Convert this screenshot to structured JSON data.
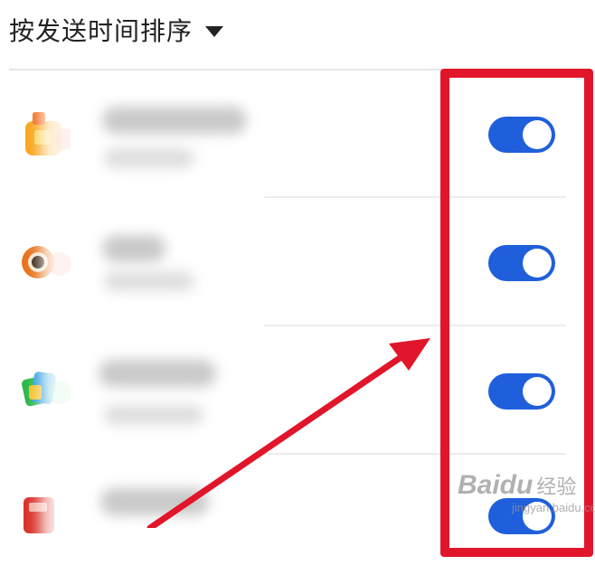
{
  "header": {
    "sort_label": "按发送时间排序"
  },
  "apps": [
    {
      "icon": "orange-gift-app-icon",
      "enabled": true
    },
    {
      "icon": "orange-eye-app-icon",
      "enabled": true
    },
    {
      "icon": "green-video-app-icon",
      "enabled": true
    },
    {
      "icon": "red-app-icon",
      "enabled": true
    }
  ],
  "annotation": {
    "box_color": "#e1162a",
    "arrow_color": "#e1162a"
  },
  "watermark": {
    "brand": "Baidu",
    "cn": "经验",
    "site": "jingyan.baidu.com"
  },
  "colors": {
    "toggle_on": "#1f5fdb"
  }
}
